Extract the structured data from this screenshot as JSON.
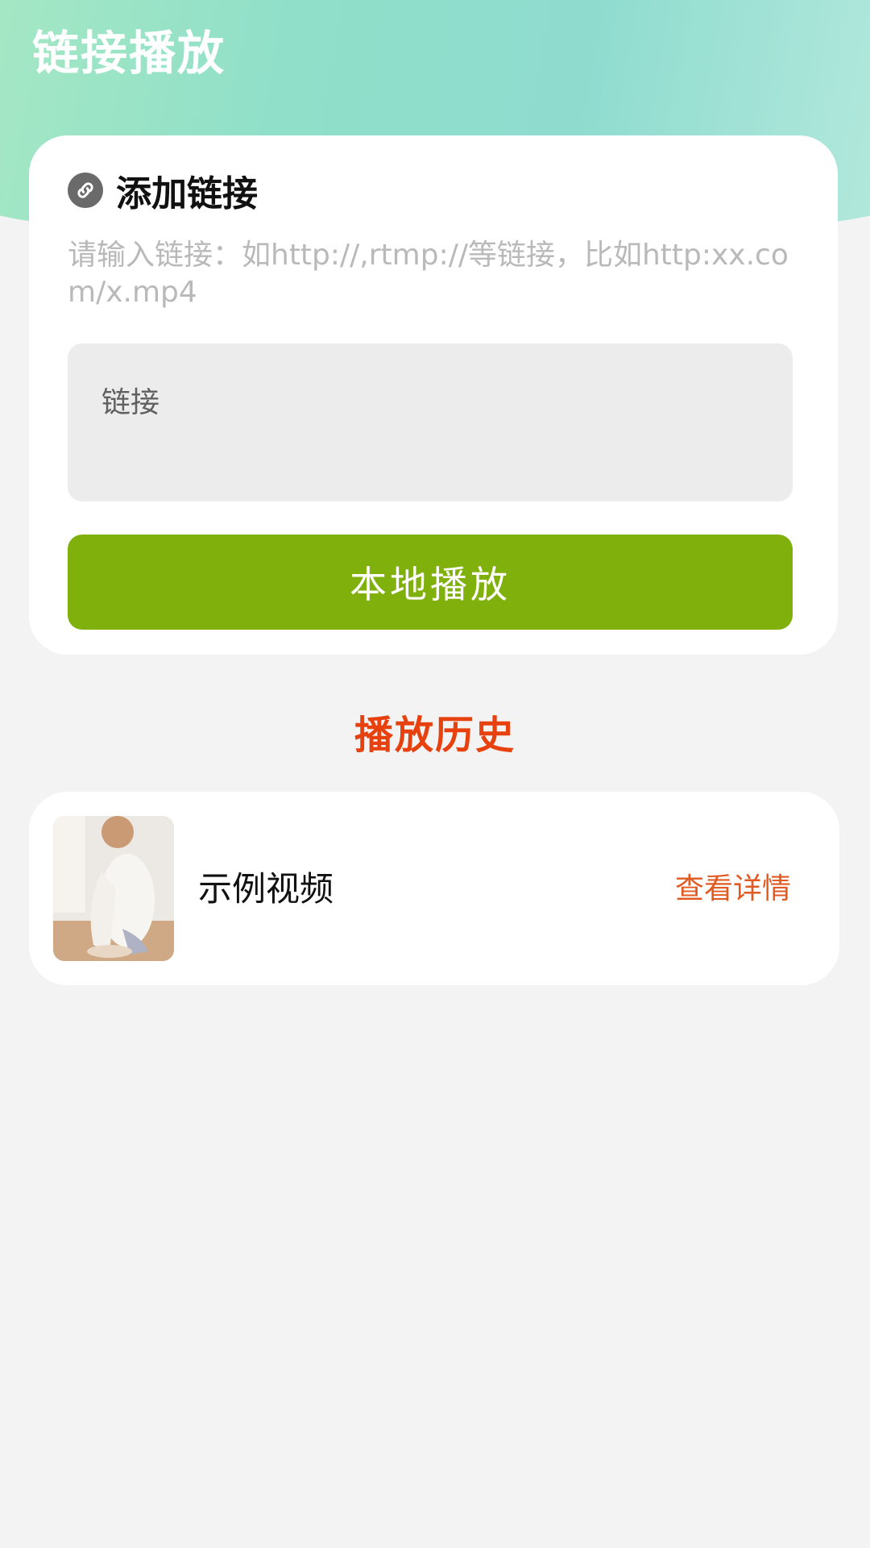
{
  "header": {
    "title": "链接播放"
  },
  "add_link": {
    "section_title": "添加链接",
    "icon": "link-icon",
    "hint": "请输入链接：如http://,rtmp://等链接，比如http:xx.com/x.mp4",
    "input_placeholder": "链接",
    "play_button_label": "本地播放"
  },
  "history": {
    "title": "播放历史",
    "items": [
      {
        "name": "示例视频",
        "detail_label": "查看详情"
      }
    ]
  },
  "colors": {
    "accent_green": "#80b00c",
    "accent_orange": "#e6410f",
    "header_gradient": [
      "#a6e8c4",
      "#8fdccf"
    ]
  }
}
